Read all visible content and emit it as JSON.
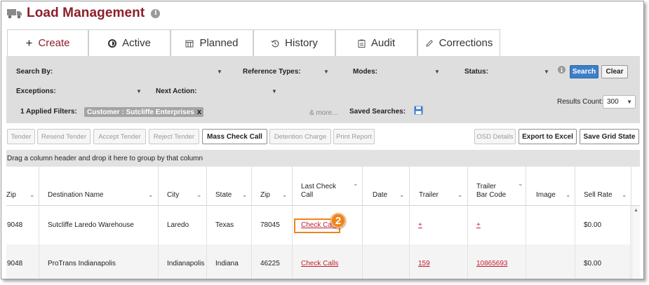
{
  "page": {
    "title": "Load Management"
  },
  "tabs": [
    {
      "label": "Create",
      "icon": "plus-icon"
    },
    {
      "label": "Active",
      "icon": "active-circle-icon"
    },
    {
      "label": "Planned",
      "icon": "calendar-icon"
    },
    {
      "label": "History",
      "icon": "history-icon"
    },
    {
      "label": "Audit",
      "icon": "clipboard-icon"
    },
    {
      "label": "Corrections",
      "icon": "pencil-icon"
    }
  ],
  "filters": {
    "search_by": "Search By:",
    "reference_types": "Reference Types:",
    "modes": "Modes:",
    "status": "Status:",
    "exceptions": "Exceptions:",
    "next_action": "Next Action:",
    "search_btn": "Search",
    "clear_btn": "Clear",
    "results_count_label": "Results Count:",
    "results_count_value": "300",
    "applied_filters": "1 Applied Filters:",
    "chip": "Customer : Sutcliffe Enterprises",
    "chip_close": "x",
    "more": "& more...",
    "saved_searches": "Saved Searches:"
  },
  "toolbar": {
    "tender": "Tender",
    "resend_tender": "Resend Tender",
    "accept_tender": "Accept Tender",
    "reject_tender": "Reject Tender",
    "mass_check_call": "Mass Check Call",
    "detention_charge": "Detention Charge",
    "print_report": "Print Report",
    "osd_details": "OSD Details",
    "export_to_excel": "Export to Excel",
    "save_grid_state": "Save Grid State"
  },
  "group_hint": "Drag a column header and drop it here to group by that column",
  "grid": {
    "columns": [
      "Zip",
      "Destination Name",
      "City",
      "State",
      "Zip",
      "Last Check Call",
      "Date",
      "Trailer",
      "Trailer Bar Code",
      "Image",
      "Sell Rate"
    ],
    "columns_split": {
      "last_check_1": "Last Check",
      "last_check_2": "Call",
      "trailer_bar_1": "Trailer",
      "trailer_bar_2": "Bar Code"
    },
    "rows": [
      {
        "zip": "9048",
        "destination": "Sutcliffe Laredo Warehouse",
        "city": "Laredo",
        "state": "Texas",
        "dest_zip": "78045",
        "last_check_call": "Check Calls",
        "date": "",
        "trailer": "+",
        "trailer_bar_code": "+",
        "image": "",
        "sell_rate": "$0.00"
      },
      {
        "zip": "9048",
        "destination": "ProTrans Indianapolis",
        "city": "Indianapolis",
        "state": "Indiana",
        "dest_zip": "46225",
        "last_check_call": "Check Calls",
        "date": "",
        "trailer": "159",
        "trailer_bar_code": "10865693",
        "image": "",
        "sell_rate": "$0.00"
      }
    ],
    "callout_number": "2"
  },
  "colors": {
    "brand": "#8b1f2b",
    "link": "#c21e2e",
    "accent": "#3d7fc7",
    "callout": "#f0831e"
  }
}
